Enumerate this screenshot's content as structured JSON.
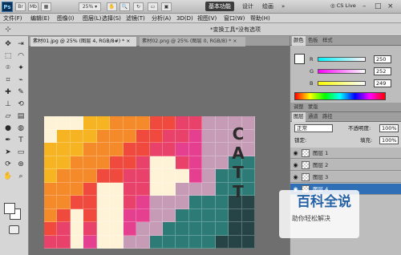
{
  "app": {
    "logo": "Ps",
    "zoom": "25%",
    "workspace": [
      "基本功能",
      "设计",
      "绘画",
      "»"
    ],
    "cslive": "CS Live",
    "window_controls": [
      "–",
      "□",
      "×"
    ]
  },
  "menu": [
    "文件(F)",
    "编辑(E)",
    "图像(I)",
    "图层(L)",
    "选择(S)",
    "滤镜(T)",
    "分析(A)",
    "3D(D)",
    "视图(V)",
    "窗口(W)",
    "帮助(H)"
  ],
  "options": {
    "text": "*变换工具*没有选项"
  },
  "tabs": [
    {
      "label": "素材01.jpg @ 25% (图层 4, RGB/8#) *"
    },
    {
      "label": "素材02.png @ 25% (图层 0, RGB/8) *"
    }
  ],
  "artboard": {
    "word": [
      "C",
      "A",
      "T",
      "T"
    ]
  },
  "color_panel": {
    "tabs": [
      "颜色",
      "色板",
      "样式"
    ],
    "channels": [
      {
        "label": "R",
        "value": "250"
      },
      {
        "label": "G",
        "value": "252"
      },
      {
        "label": "B",
        "value": "249"
      }
    ]
  },
  "layers_panel": {
    "tabs": [
      "调整",
      "蒙版"
    ],
    "tabs2": [
      "图层",
      "通道",
      "路径"
    ],
    "blend_mode": "正常",
    "opacity_label": "不透明度:",
    "opacity_value": "100%",
    "lock_label": "锁定:",
    "fill_label": "填充:",
    "fill_value": "100%",
    "layers": [
      {
        "name": "图层 1"
      },
      {
        "name": "图层 2"
      },
      {
        "name": "图层 3"
      },
      {
        "name": "图层 4"
      }
    ]
  },
  "watermark": {
    "title": "百科全说",
    "subtitle": "助你轻松解决"
  }
}
